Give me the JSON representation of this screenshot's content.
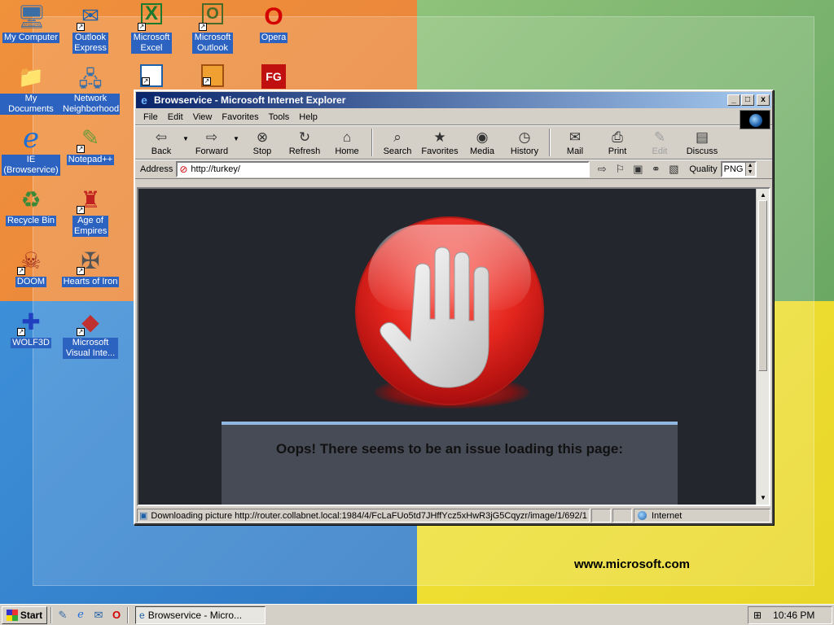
{
  "desktop": {
    "brand_text": "www.microsoft.com",
    "icons": [
      {
        "label": "My Computer",
        "glyph": "🖥",
        "color": "#3a6ea5"
      },
      {
        "label": "Outlook Express",
        "glyph": "✉",
        "color": "#1e5fa8"
      },
      {
        "label": "Microsoft Excel",
        "glyph": "X",
        "color": "#1d7a2d"
      },
      {
        "label": "Microsoft Outlook",
        "glyph": "O",
        "color": "#4a6a2a"
      },
      {
        "label": "Opera",
        "glyph": "O",
        "color": "#d40000"
      },
      {
        "label": "My Documents",
        "glyph": "📁",
        "color": "#d8b040"
      },
      {
        "label": "Network Neighborhood",
        "glyph": "🖧",
        "color": "#3a6ea5"
      },
      {
        "label": "IE (Browservice)",
        "glyph": "e",
        "color": "#1e6fd6"
      },
      {
        "label": "Notepad++",
        "glyph": "✎",
        "color": "#6a9a3a"
      },
      {
        "label": "Recycle Bin",
        "glyph": "♻",
        "color": "#3a8a3a"
      },
      {
        "label": "Age of Empires",
        "glyph": "♜",
        "color": "#c02020"
      },
      {
        "label": "DOOM",
        "glyph": "☠",
        "color": "#a03020"
      },
      {
        "label": "Hearts of Iron",
        "glyph": "✠",
        "color": "#555"
      },
      {
        "label": "WOLF3D",
        "glyph": "✚",
        "color": "#2040c0"
      },
      {
        "label": "Microsoft Visual Inte...",
        "glyph": "◆",
        "color": "#c03030"
      }
    ]
  },
  "window": {
    "title": "Browservice - Microsoft Internet Explorer",
    "controls": {
      "minimize": "_",
      "maximize": "□",
      "close": "x"
    },
    "menu": [
      "File",
      "Edit",
      "View",
      "Favorites",
      "Tools",
      "Help"
    ],
    "toolbar": {
      "back": "Back",
      "forward": "Forward",
      "stop": "Stop",
      "refresh": "Refresh",
      "home": "Home",
      "search": "Search",
      "favorites": "Favorites",
      "media": "Media",
      "history": "History",
      "mail": "Mail",
      "print": "Print",
      "edit": "Edit",
      "discuss": "Discuss"
    },
    "address": {
      "label": "Address",
      "value": "http://turkey/"
    },
    "quality": {
      "label": "Quality",
      "value": "PNG"
    },
    "page": {
      "error_title": "Oops! There seems to be an issue loading this page:"
    },
    "status": {
      "text": "Downloading picture http://router.collabnet.local:1984/4/FcLaFUo5td7JHffYcz5xHwR3jG5Cqyzr/image/1/692/1",
      "zone": "Internet"
    }
  },
  "taskbar": {
    "start_label": "Start",
    "task_label": "Browservice - Micro...",
    "clock": "10:46 PM"
  },
  "colors": {
    "titlebar_start": "#0a246a",
    "titlebar_end": "#a6caf0",
    "page_background": "#23262d",
    "stop_red": "#e4261e",
    "panel_border": "#8fb7e0"
  }
}
